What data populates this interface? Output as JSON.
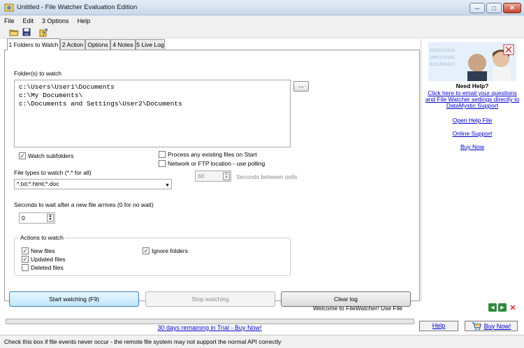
{
  "window": {
    "title": "Untitled - File Watcher Evaluation Edition",
    "min_glyph": "─",
    "max_glyph": "□",
    "close_glyph": "✕"
  },
  "menubar": [
    "File",
    "Edit",
    "3 Options",
    "Help"
  ],
  "toolbar": {
    "icons": [
      "open-folder-icon",
      "save-icon",
      "info-icon"
    ]
  },
  "tabs": [
    "1 Folders to Watch",
    "2 Action",
    "Options",
    "4 Notes",
    "5 Live Log"
  ],
  "folders": {
    "label": "Folder(s) to watch",
    "lines": [
      "c:\\Users\\User1\\Documents",
      "c:\\My Documents\\",
      "c:\\Documents and Settings\\User2\\Documents"
    ],
    "browse_label": "..."
  },
  "checks": {
    "watch_subfolders": {
      "label": "Watch subfolders",
      "checked": true
    },
    "process_existing": {
      "label": "Process any existing files on Start",
      "checked": false
    },
    "network_ftp": {
      "label": "Network or FTP location - use polling",
      "checked": false
    }
  },
  "poll": {
    "value": "60",
    "label": "Seconds between polls"
  },
  "filetypes": {
    "label": "File types to watch (*.* for all)",
    "value": "*.txt;*.html;*.doc"
  },
  "wait": {
    "label": "Seconds to wait after a new file arrives (0 for no wait)",
    "value": "0"
  },
  "actions": {
    "legend": "Actions to watch",
    "new_files": {
      "label": "New files",
      "checked": true
    },
    "updated_files": {
      "label": "Updated files",
      "checked": true
    },
    "deleted_files": {
      "label": "Deleted files",
      "checked": false
    },
    "ignore_folders": {
      "label": "Ignore folders",
      "checked": true
    }
  },
  "buttons": {
    "start": "Start watching (F9)",
    "stop": "Stop watching",
    "clear": "Clear log"
  },
  "help_panel": {
    "heading": "Need Help?",
    "email_link": "Click here to email your questions and File Watcher settings directly to DataMystic Support",
    "open_help": "Open Help File",
    "online_support": "Online Support",
    "buy_now": "Buy Now"
  },
  "marquee": "Welcome to FileWatcher! Use File",
  "trial_link": "30 days remaining in Trial - Buy Now!",
  "bottom_buttons": {
    "help": "Help",
    "buy_now": "Buy Now!"
  },
  "statusbar": "Check this box if file events never occur - the remote file system may not support the normal API correctly",
  "check_glyph": "✓",
  "colors": {
    "accent": "#3c7fb1",
    "link": "#0000cc",
    "close": "#c4442d"
  }
}
